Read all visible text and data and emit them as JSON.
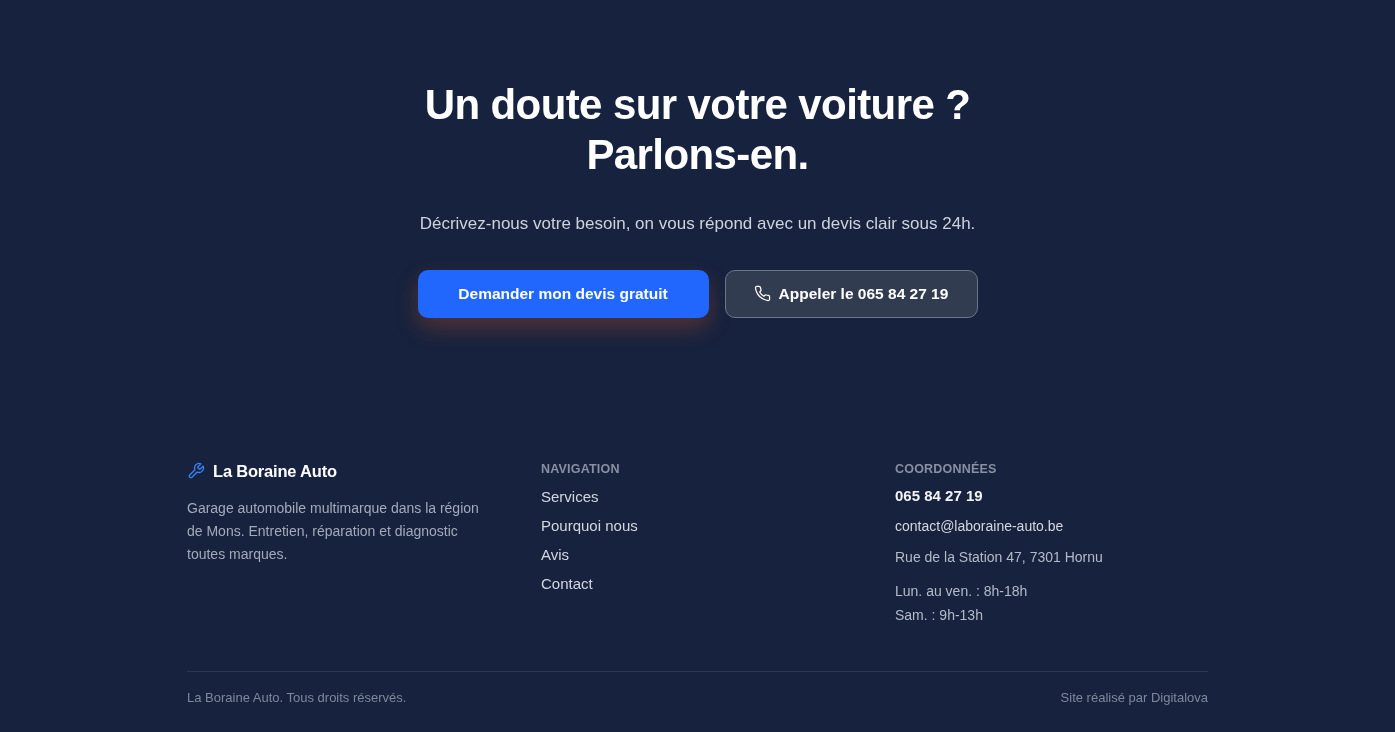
{
  "hero": {
    "title_lines": [
      "Un doute sur votre voiture ?",
      "Parlons-en."
    ],
    "subtitle": "Décrivez-nous votre besoin, on vous répond avec un devis clair sous 24h.",
    "buttons": [
      {
        "kind": "primary",
        "label": "Demander mon devis gratuit"
      },
      {
        "kind": "call",
        "label": "Appeler le 065 84 27 19"
      }
    ]
  },
  "footer": {
    "brand": {
      "name": "La Boraine Auto",
      "description": "Garage automobile multimarque dans la région de Mons. Entretien, réparation et diagnostic toutes marques."
    },
    "navigation": {
      "heading": "NAVIGATION",
      "links": [
        "Services",
        "Pourquoi nous",
        "Avis",
        "Contact"
      ]
    },
    "contact": {
      "heading": "COORDONNÉES",
      "phone": "065 84 27 19",
      "email": "contact@laboraine-auto.be",
      "address": "Rue de la Station 47, 7301 Hornu",
      "hours": [
        "Lun. au ven. : 8h-18h",
        "Sam. : 9h-13h"
      ]
    },
    "bottom": {
      "copyright": "La Boraine Auto. Tous droits réservés.",
      "credit": "Site réalisé par Digitalova"
    }
  }
}
